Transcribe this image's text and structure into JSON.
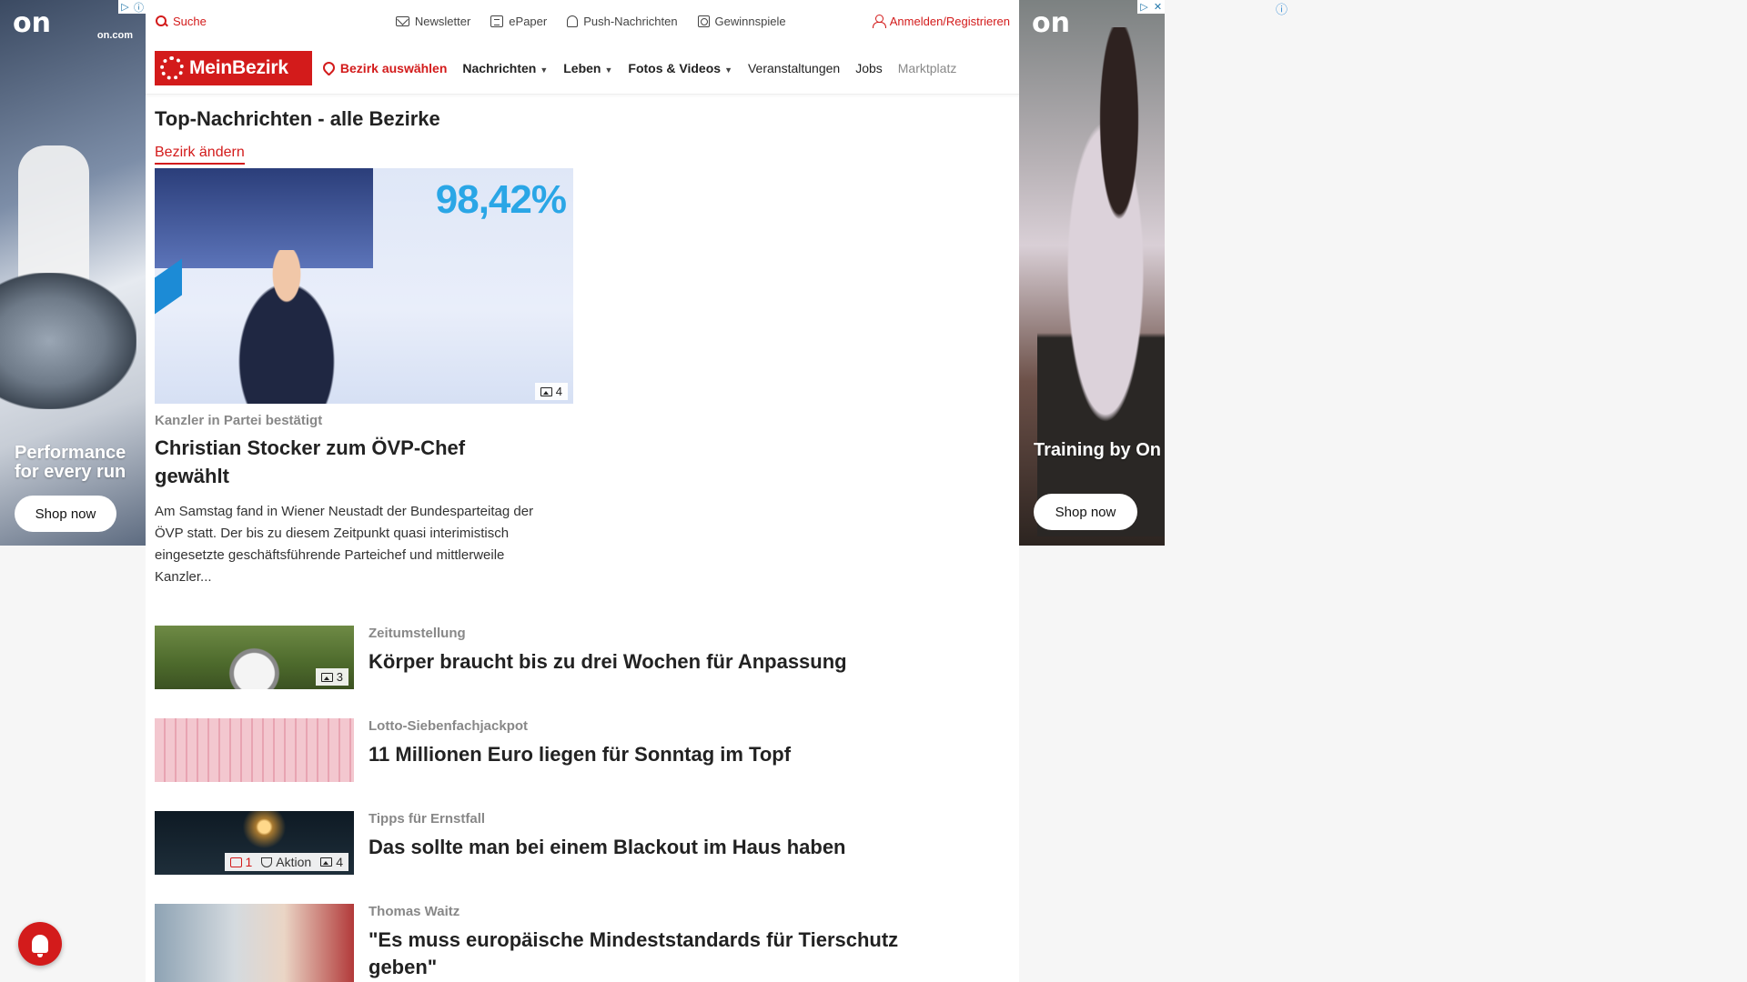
{
  "topbar": {
    "search": "Suche",
    "links": [
      "Newsletter",
      "ePaper",
      "Push-Nachrichten",
      "Gewinnspiele"
    ],
    "login": "Anmelden/Registrieren"
  },
  "nav": {
    "logo": "MeinBezirk",
    "bezirk": "Bezirk auswählen",
    "items": [
      "Nachrichten",
      "Leben",
      "Fotos & Videos",
      "Veranstaltungen",
      "Jobs",
      "Marktplatz"
    ]
  },
  "section": {
    "title": "Top-Nachrichten - alle Bezirke",
    "change_link": "Bezirk ändern"
  },
  "lead": {
    "image_text": "98,42%",
    "photo_count": "4",
    "kicker": "Kanzler in Partei bestätigt",
    "headline": "Christian Stocker zum ÖVP-Chef gewählt",
    "teaser": "Am Samstag fand in Wiener Neustadt der Bundesparteitag der ÖVP statt. Der bis zu diesem Zeitpunkt quasi interimistisch eingesetzte geschäftsführende Parteichef und mittlerweile Kanzler..."
  },
  "articles": [
    {
      "kicker": "Zeitumstellung",
      "headline": "Körper braucht bis zu drei Wochen für Anpassung",
      "photos": "3"
    },
    {
      "kicker": "Lotto-Siebenfachjackpot",
      "headline": "11 Millionen Euro liegen für Sonntag im Topf"
    },
    {
      "kicker": "Tipps für Ernstfall",
      "headline": "Das sollte man bei einem Blackout im Haus haben",
      "comments": "1",
      "action": "Aktion",
      "photos": "4"
    },
    {
      "kicker": "Thomas Waitz",
      "headline": "\"Es muss europäische Mindeststandards für Tierschutz geben\""
    }
  ],
  "ads": {
    "left": {
      "logo": "on",
      "site": "on.com",
      "headline": "Performance for every run",
      "cta": "Shop now"
    },
    "right": {
      "logo": "on",
      "headline": "Training by On",
      "cta": "Shop now"
    }
  },
  "icons": {
    "search": "search-icon",
    "newsletter": "mail-icon",
    "epaper": "newspaper-icon",
    "push": "bell-icon",
    "gewinnspiele": "gift-icon",
    "login": "user-icon",
    "bezirk": "location-pin-icon",
    "photos": "image-icon",
    "comments": "comment-icon",
    "action": "trophy-icon",
    "fab": "notification-bell-icon"
  },
  "colors": {
    "brand": "#d31b1b",
    "text": "#222222",
    "kicker": "#888888"
  }
}
